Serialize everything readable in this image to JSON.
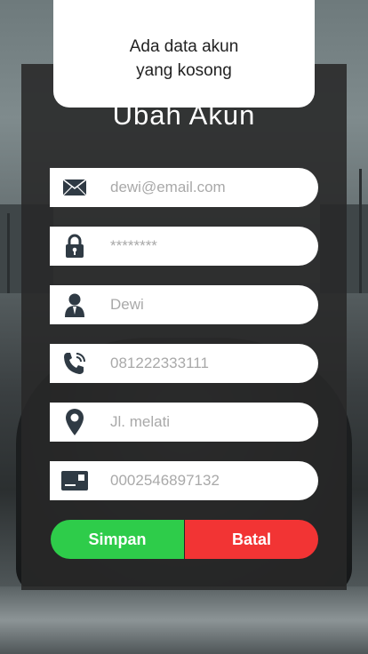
{
  "toast": {
    "line1": "Ada data akun",
    "line2": "yang kosong"
  },
  "form": {
    "title": "Ubah Akun",
    "fields": [
      {
        "icon": "envelope-icon",
        "value": "dewi@email.com"
      },
      {
        "icon": "lock-icon",
        "value": "********"
      },
      {
        "icon": "person-icon",
        "value": "Dewi"
      },
      {
        "icon": "phone-icon",
        "value": "081222333111"
      },
      {
        "icon": "location-pin-icon",
        "value": "Jl. melati"
      },
      {
        "icon": "id-card-icon",
        "value": "0002546897132"
      }
    ],
    "save_label": "Simpan",
    "cancel_label": "Batal"
  },
  "colors": {
    "save": "#2ecc4a",
    "cancel": "#f23434",
    "panel": "#282828",
    "icon": "#2f3a44"
  }
}
